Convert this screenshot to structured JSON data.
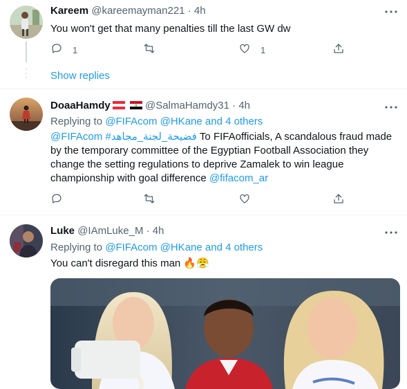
{
  "tweets": [
    {
      "name": "Kareem",
      "handle": "@kareemayman221",
      "sep": "·",
      "time": "4h",
      "text": "You won't get that many penalties till the last GW dw",
      "reply_count": "1",
      "like_count": "1",
      "show_replies": "Show replies"
    },
    {
      "name": "DoaaHamdy",
      "handle": "@SalmaHamdy31",
      "sep": "·",
      "time": "4h",
      "replying_prefix": "Replying to ",
      "mention1": "@FIFAcom",
      "mention2": "@HKane",
      "and_others": "and 4 others",
      "hashtag_line": "@FIFAcom #فضيحة_لجنة_مجاهد",
      "text_rest": " To FIFAofficials, A scandalous fraud made by the temporary committee of the Egyptian Football Association they change the setting regulations to deprive Zamalek to win league championship with goal difference ",
      "mention_end": "@fifacom_ar"
    },
    {
      "name": "Luke",
      "handle": "@IAmLuke_M",
      "sep": "·",
      "time": "4h",
      "replying_prefix": "Replying to ",
      "mention1": "@FIFAcom",
      "mention2": "@HKane",
      "and_others": "and 4 others",
      "text": "You can't disregard this man 🔥😤"
    }
  ],
  "icons": {
    "reply": "reply-icon",
    "retweet": "retweet-icon",
    "like": "heart-icon",
    "share": "share-icon",
    "more": "more-icon"
  },
  "colors": {
    "link": "#1d9bf0",
    "secondary": "#536471",
    "text": "#0f1419"
  }
}
